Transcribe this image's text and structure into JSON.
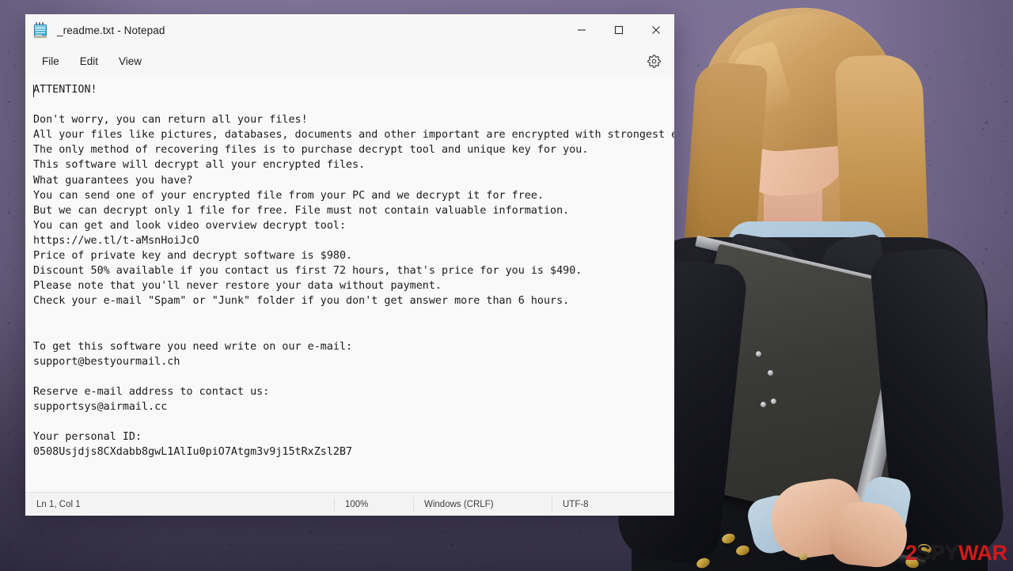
{
  "window": {
    "title": "_readme.txt - Notepad",
    "icon": "notepad-icon",
    "controls": {
      "minimize": "minimize-icon",
      "maximize": "maximize-icon",
      "close": "close-icon"
    }
  },
  "menu": {
    "items": [
      {
        "label": "File"
      },
      {
        "label": "Edit"
      },
      {
        "label": "View"
      }
    ],
    "settings_icon": "gear-icon"
  },
  "editor": {
    "content": "ATTENTION!\n\nDon't worry, you can return all your files!\nAll your files like pictures, databases, documents and other important are encrypted with strongest encryption and unique key.\nThe only method of recovering files is to purchase decrypt tool and unique key for you.\nThis software will decrypt all your encrypted files.\nWhat guarantees you have?\nYou can send one of your encrypted file from your PC and we decrypt it for free.\nBut we can decrypt only 1 file for free. File must not contain valuable information.\nYou can get and look video overview decrypt tool:\nhttps://we.tl/t-aMsnHoiJcO\nPrice of private key and decrypt software is $980.\nDiscount 50% available if you contact us first 72 hours, that's price for you is $490.\nPlease note that you'll never restore your data without payment.\nCheck your e-mail \"Spam\" or \"Junk\" folder if you don't get answer more than 6 hours.\n\n\nTo get this software you need write on our e-mail:\nsupport@bestyourmail.ch\n\nReserve e-mail address to contact us:\nsupportsys@airmail.cc\n\nYour personal ID:\n0508Usjdjs8CXdabb8gwL1AlIu0piO7Atgm3v9j15tRxZsl2B7"
  },
  "status_bar": {
    "position": "Ln 1, Col 1",
    "zoom": "100%",
    "line_ending": "Windows (CRLF)",
    "encoding": "UTF-8"
  },
  "watermark": {
    "part1": "2",
    "part2": "SPY",
    "part3": "WAR"
  },
  "colors": {
    "backdrop": "#7a6f92",
    "window": "#f7f7f7",
    "editor_bg": "#f9f9f9",
    "status_bg": "#f3f3f3",
    "text": "#1a1a1a",
    "watermark_red": "#c81e1e",
    "blazer": "#16171c",
    "hair": "#c79a5e"
  }
}
